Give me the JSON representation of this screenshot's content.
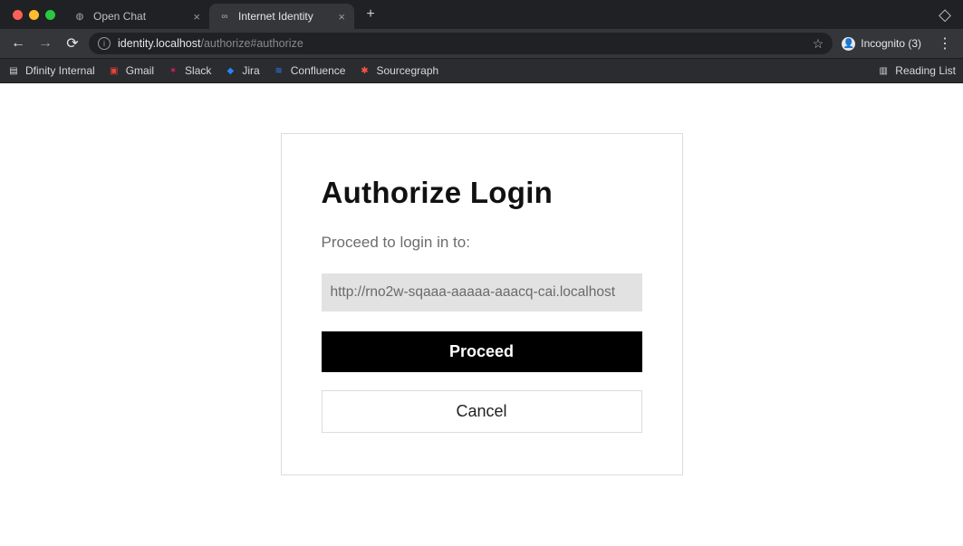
{
  "browser": {
    "tabs": [
      {
        "title": "Open Chat",
        "active": false
      },
      {
        "title": "Internet Identity",
        "active": true
      }
    ],
    "url": {
      "host": "identity.localhost",
      "path": "/authorize#authorize"
    },
    "profile_label": "Incognito (3)",
    "bookmarks": [
      {
        "label": "Dfinity Internal",
        "color": "#9aa0a6"
      },
      {
        "label": "Gmail",
        "color": "#ea4335"
      },
      {
        "label": "Slack",
        "color": "#e01e5a"
      },
      {
        "label": "Jira",
        "color": "#2684ff"
      },
      {
        "label": "Confluence",
        "color": "#2684ff"
      },
      {
        "label": "Sourcegraph",
        "color": "#ff5543"
      }
    ],
    "reading_list_label": "Reading List"
  },
  "page": {
    "title": "Authorize Login",
    "subtitle": "Proceed to login in to:",
    "target_url": "http://rno2w-sqaaa-aaaaa-aaacq-cai.localhost",
    "proceed_label": "Proceed",
    "cancel_label": "Cancel"
  }
}
